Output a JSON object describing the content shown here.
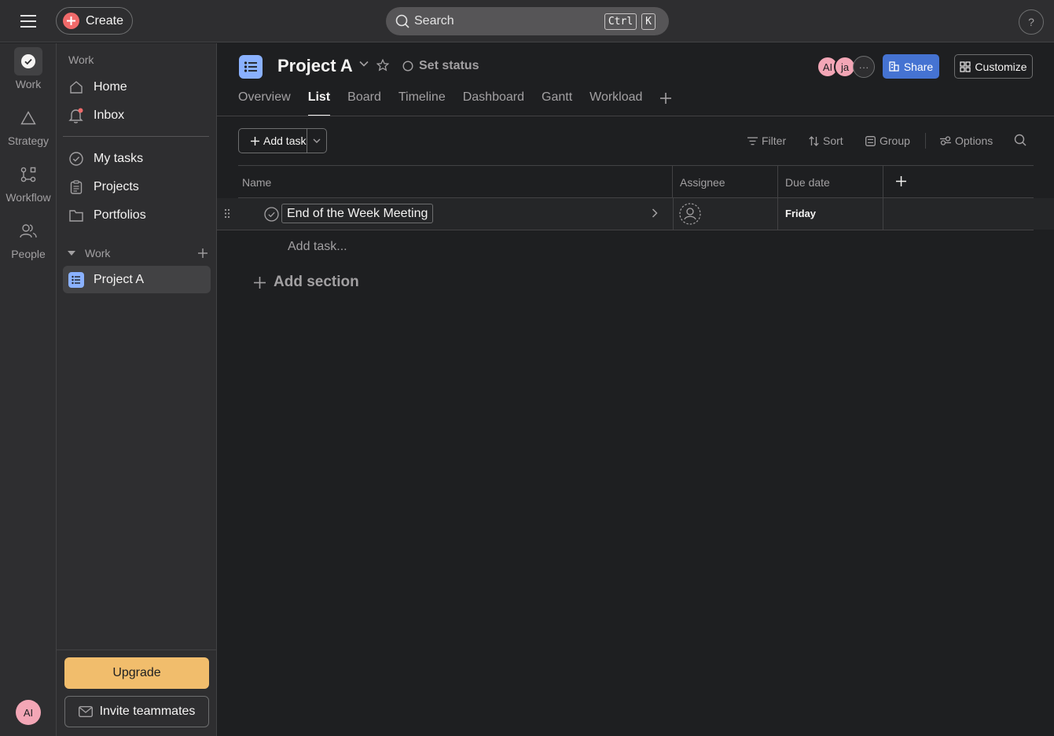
{
  "topbar": {
    "create_label": "Create",
    "search_placeholder": "Search",
    "shortcut_ctrl": "Ctrl",
    "shortcut_k": "K",
    "help_label": "?"
  },
  "rail": {
    "items": [
      {
        "label": "Work",
        "icon": "check-circle-icon"
      },
      {
        "label": "Strategy",
        "icon": "triangle-icon"
      },
      {
        "label": "Workflow",
        "icon": "workflow-icon"
      },
      {
        "label": "People",
        "icon": "people-icon"
      }
    ],
    "avatar_initials": "AI"
  },
  "sidebar": {
    "header": "Work",
    "nav": [
      {
        "label": "Home",
        "icon": "home-icon"
      },
      {
        "label": "Inbox",
        "icon": "bell-icon"
      }
    ],
    "links": [
      {
        "label": "My tasks",
        "icon": "check-circle-icon"
      },
      {
        "label": "Projects",
        "icon": "clipboard-icon"
      },
      {
        "label": "Portfolios",
        "icon": "folder-icon"
      }
    ],
    "section_label": "Work",
    "project_label": "Project A",
    "upgrade_label": "Upgrade",
    "invite_label": "Invite teammates"
  },
  "project": {
    "title": "Project A",
    "set_status": "Set status",
    "members": [
      "AI",
      "ja"
    ],
    "more_members": "···",
    "share_label": "Share",
    "customize_label": "Customize",
    "tabs": [
      "Overview",
      "List",
      "Board",
      "Timeline",
      "Dashboard",
      "Gantt",
      "Workload"
    ],
    "active_tab": "List"
  },
  "toolbar": {
    "add_task": "Add task",
    "filter": "Filter",
    "sort": "Sort",
    "group": "Group",
    "options": "Options"
  },
  "table": {
    "columns": [
      "Name",
      "Assignee",
      "Due date"
    ],
    "rows": [
      {
        "name": "End of the Week Meeting",
        "assignee": "",
        "due": "Friday"
      }
    ],
    "add_task_placeholder": "Add task...",
    "add_section": "Add section"
  },
  "colors": {
    "accent": "#4573d2",
    "create": "#f06a6a",
    "upgrade": "#f1bd6c",
    "project_icon": "#8ab1ff",
    "avatar": "#f3a6b6"
  }
}
